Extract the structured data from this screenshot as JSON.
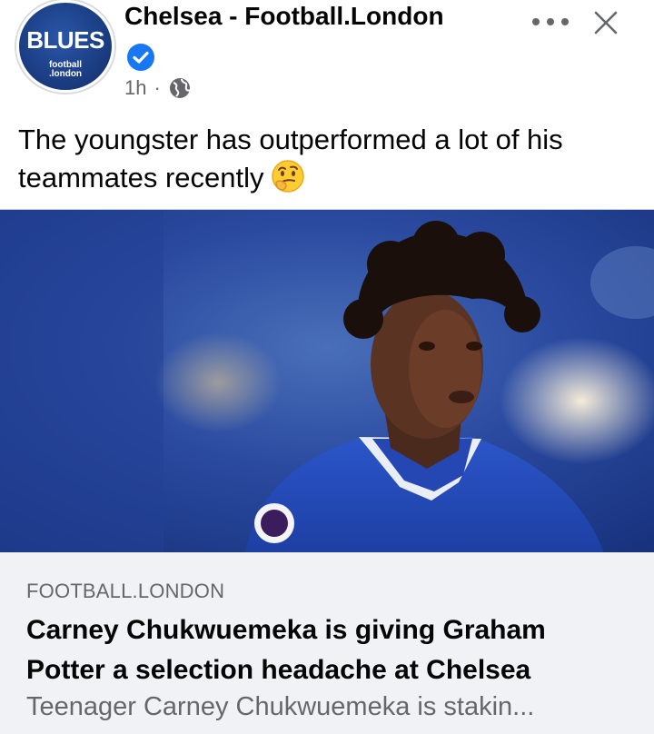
{
  "post": {
    "page_name": "Chelsea - Football.London",
    "avatar": {
      "main": "BLUES",
      "sub_line1": "football",
      "sub_line2": ".london"
    },
    "time": "1h",
    "separator": "·",
    "audience_icon": "globe-icon",
    "verified_icon": "verified-badge-icon",
    "text": "The youngster has outperformed a lot of his teammates recently",
    "emoji_icon": "thinking-face-emoji",
    "menu_icon": "more-horizontal-icon",
    "close_icon": "close-icon"
  },
  "link_preview": {
    "image": "football-player-photo",
    "domain": "FOOTBALL.LONDON",
    "title": "Carney Chukwuemeka is giving Graham Potter a selection headache at Chelsea",
    "description": "Teenager Carney Chukwuemeka is stakin..."
  },
  "colors": {
    "brand_blue": "#1877f2",
    "chelsea_blue": "#1c3f86",
    "secondary_text": "#65676b",
    "link_box_bg": "#f0f2f5"
  }
}
